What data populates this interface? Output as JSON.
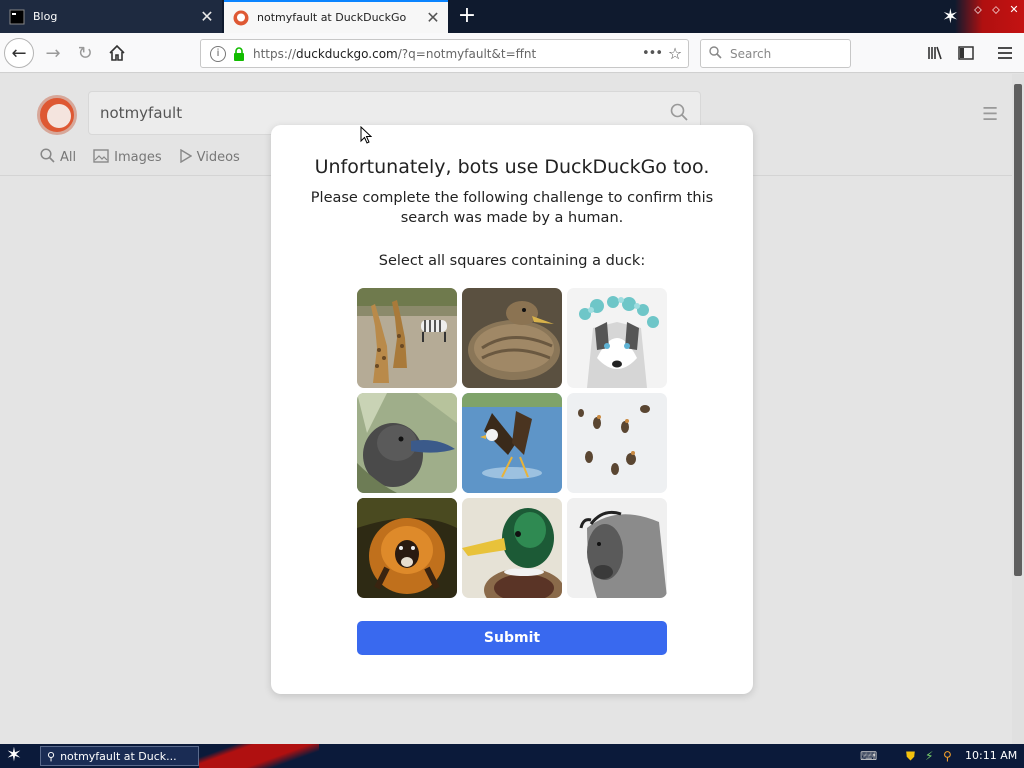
{
  "tabs": [
    {
      "title": "Blog",
      "active": false
    },
    {
      "title": "notmyfault at DuckDuckGo",
      "active": true
    }
  ],
  "window_controls": {
    "new_tab": "+"
  },
  "nav": {
    "url_prefix": "https://",
    "url_domain": "duckduckgo.com",
    "url_rest": "/?q=notmyfault&t=ffnt",
    "search_placeholder": "Search"
  },
  "ddg": {
    "query": "notmyfault",
    "tabs": [
      "All",
      "Images",
      "Videos"
    ]
  },
  "captcha": {
    "title": "Unfortunately, bots use DuckDuckGo too.",
    "subtitle": "Please complete the following challenge to confirm this search was made by a human.",
    "prompt": "Select all squares containing a duck:",
    "tiles": [
      "giraffes-and-zebra",
      "duck",
      "husky-with-flower-crown",
      "duck",
      "eagle",
      "ducks-in-snow",
      "monkey",
      "mallard-duck",
      "bison"
    ],
    "submit_label": "Submit"
  },
  "taskbar": {
    "task_label": "notmyfault at Duck...",
    "clock": "10:11 AM"
  },
  "colors": {
    "accent": "#3969ef",
    "ddg_orange": "#de5833",
    "tab_highlight": "#0a84ff"
  }
}
